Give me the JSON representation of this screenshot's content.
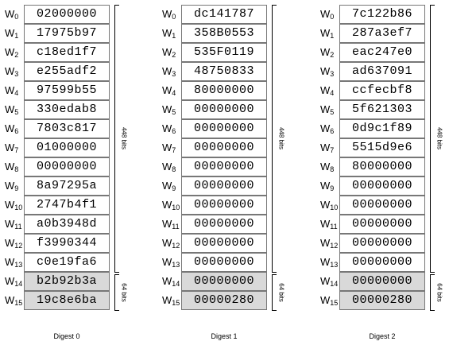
{
  "bracket_labels": {
    "top": "448 bits",
    "bottom": "64 bits"
  },
  "digests": [
    {
      "caption": "Digest 0",
      "words": [
        "02000000",
        "17975b97",
        "c18ed1f7",
        "e255adf2",
        "97599b55",
        "330edab8",
        "7803c817",
        "01000000",
        "00000000",
        "8a97295a",
        "2747b4f1",
        "a0b3948d",
        "f3990344",
        "c0e19fa6",
        "b2b92b3a",
        "19c8e6ba"
      ]
    },
    {
      "caption": "Digest 1",
      "words": [
        "dc141787",
        "358B0553",
        "535F0119",
        "48750833",
        "80000000",
        "00000000",
        "00000000",
        "00000000",
        "00000000",
        "00000000",
        "00000000",
        "00000000",
        "00000000",
        "00000000",
        "00000000",
        "00000280"
      ]
    },
    {
      "caption": "Digest 2",
      "words": [
        "7c122b86",
        "287a3ef7",
        "eac247e0",
        "ad637091",
        "ccfecbf8",
        "5f621303",
        "0d9c1f89",
        "5515d9e6",
        "80000000",
        "00000000",
        "00000000",
        "00000000",
        "00000000",
        "00000000",
        "00000000",
        "00000280"
      ]
    }
  ],
  "word_labels": {
    "prefix": "W",
    "indices": [
      "0",
      "1",
      "2",
      "3",
      "4",
      "5",
      "6",
      "7",
      "8",
      "9",
      "10",
      "11",
      "12",
      "13",
      "14",
      "15"
    ]
  },
  "colors": {
    "shaded_cell": "#d9d9d9",
    "cell_border": "#777777"
  }
}
